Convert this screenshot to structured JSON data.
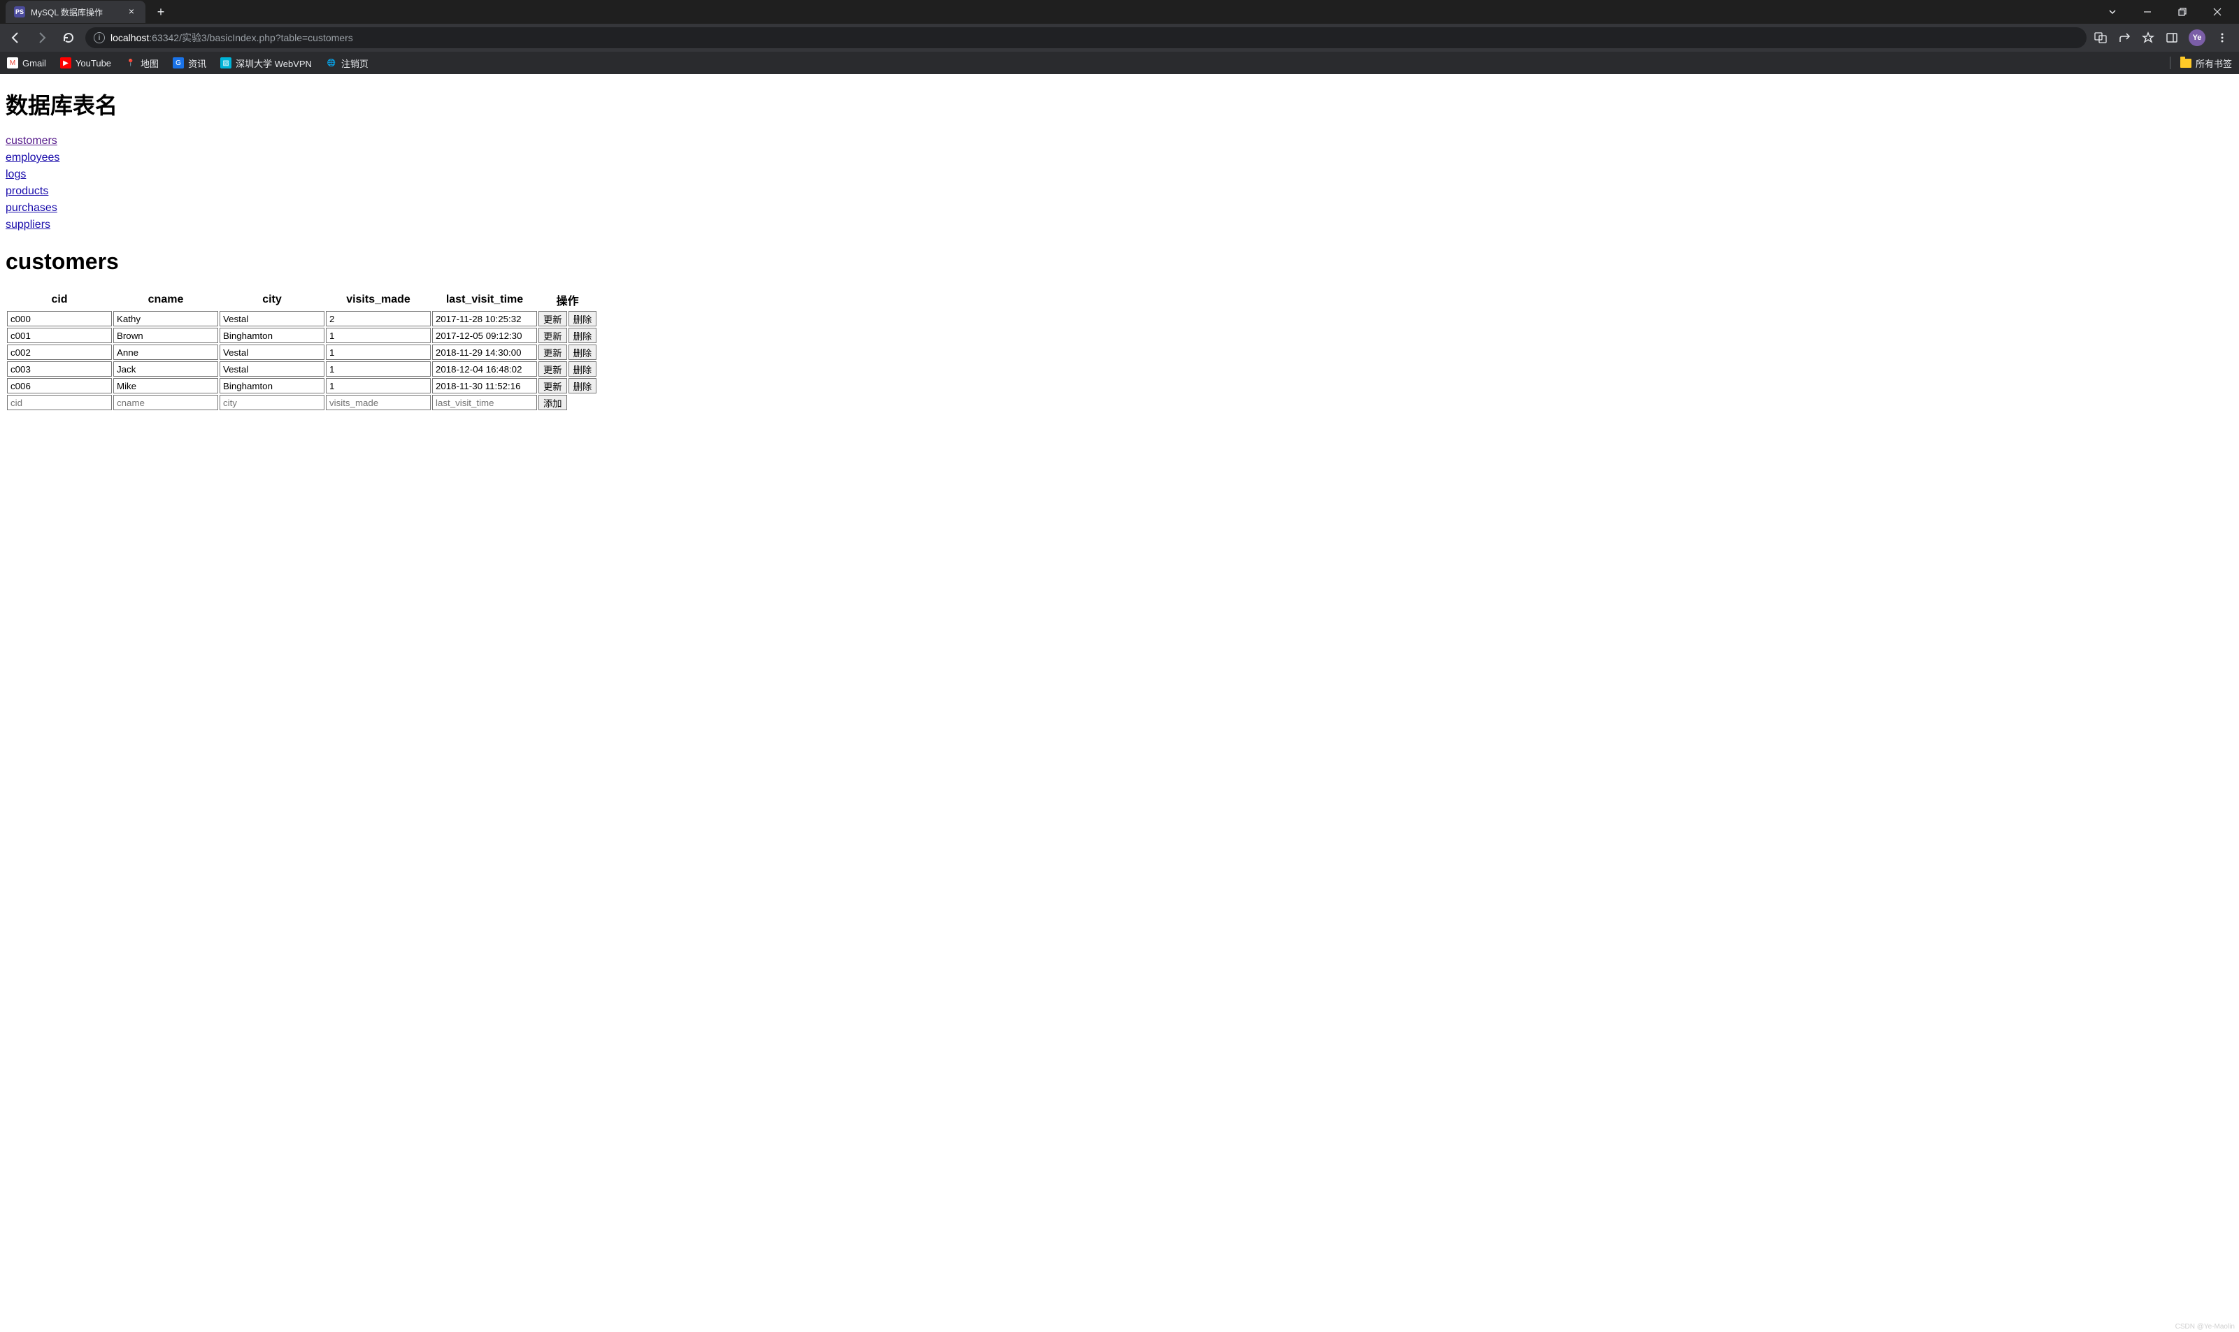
{
  "browser": {
    "tab_title": "MySQL 数据库操作",
    "favicon_text": "PS",
    "url_host": "localhost",
    "url_port": ":63342",
    "url_path": "/实验3/basicIndex.php?table=customers",
    "avatar_text": "Ye"
  },
  "bookmarks": [
    {
      "label": "Gmail",
      "icon_bg": "#fff",
      "icon_fg": "#ea4335",
      "glyph": "M"
    },
    {
      "label": "YouTube",
      "icon_bg": "#ff0000",
      "icon_fg": "#fff",
      "glyph": "▶"
    },
    {
      "label": "地图",
      "icon_bg": "transparent",
      "icon_fg": "#34a853",
      "glyph": "📍"
    },
    {
      "label": "资讯",
      "icon_bg": "#1a73e8",
      "icon_fg": "#fff",
      "glyph": "G"
    },
    {
      "label": "深圳大学 WebVPN",
      "icon_bg": "#00b4d8",
      "icon_fg": "#fff",
      "glyph": "▧"
    },
    {
      "label": "注销页",
      "icon_bg": "transparent",
      "icon_fg": "#fff",
      "glyph": "🌐"
    }
  ],
  "all_bookmarks_label": "所有书签",
  "page": {
    "heading": "数据库表名",
    "table_links": [
      {
        "label": "customers",
        "visited": true
      },
      {
        "label": "employees",
        "visited": false
      },
      {
        "label": "logs",
        "visited": false
      },
      {
        "label": "products",
        "visited": false
      },
      {
        "label": "purchases",
        "visited": false
      },
      {
        "label": "suppliers",
        "visited": false
      }
    ],
    "current_table": "customers",
    "columns": [
      "cid",
      "cname",
      "city",
      "visits_made",
      "last_visit_time"
    ],
    "ops_header": "操作",
    "rows": [
      {
        "cid": "c000",
        "cname": "Kathy",
        "city": "Vestal",
        "visits_made": "2",
        "last_visit_time": "2017-11-28 10:25:32"
      },
      {
        "cid": "c001",
        "cname": "Brown",
        "city": "Binghamton",
        "visits_made": "1",
        "last_visit_time": "2017-12-05 09:12:30"
      },
      {
        "cid": "c002",
        "cname": "Anne",
        "city": "Vestal",
        "visits_made": "1",
        "last_visit_time": "2018-11-29 14:30:00"
      },
      {
        "cid": "c003",
        "cname": "Jack",
        "city": "Vestal",
        "visits_made": "1",
        "last_visit_time": "2018-12-04 16:48:02"
      },
      {
        "cid": "c006",
        "cname": "Mike",
        "city": "Binghamton",
        "visits_made": "1",
        "last_visit_time": "2018-11-30 11:52:16"
      }
    ],
    "placeholders": {
      "cid": "cid",
      "cname": "cname",
      "city": "city",
      "visits_made": "visits_made",
      "last_visit_time": "last_visit_time"
    },
    "buttons": {
      "update": "更新",
      "delete": "删除",
      "add": "添加"
    }
  },
  "watermark": "CSDN @Ye-Maolin"
}
